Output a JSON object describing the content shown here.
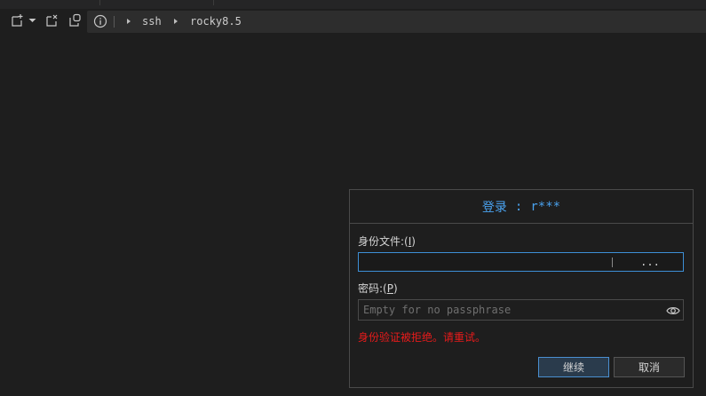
{
  "toolbar": {
    "icons": [
      "new-tab-icon",
      "dropdown-arrow-icon",
      "close-tab-icon",
      "duplicate-tab-icon"
    ],
    "breadcrumb": [
      "ssh",
      "rocky8.5"
    ]
  },
  "dialog": {
    "title_label": "登录",
    "title_separator": ":",
    "title_user": "r***",
    "identity_label": "身份文件:(",
    "identity_mnemonic": "I",
    "identity_label_end": ")",
    "identity_value": "",
    "browse_label": "...",
    "password_label": "密码:(",
    "password_mnemonic": "P",
    "password_label_end": ")",
    "password_placeholder": "Empty for no passphrase",
    "error_message": "身份验证被拒绝。请重试。",
    "continue_label": "继续",
    "cancel_label": "取消"
  },
  "colors": {
    "accent": "#4aa3f0",
    "error": "#e81b1b",
    "background": "#1e1e1e"
  }
}
